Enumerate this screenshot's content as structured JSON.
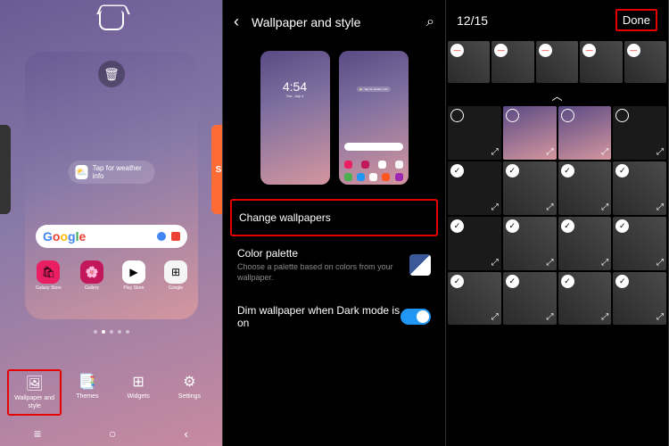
{
  "panel1": {
    "weather_text": "Tap for weather info",
    "apps": [
      {
        "name": "Galaxy Store"
      },
      {
        "name": "Gallery"
      },
      {
        "name": "Play Store"
      },
      {
        "name": "Google"
      }
    ],
    "bottom_items": [
      {
        "icon": "image-icon",
        "label": "Wallpaper and style"
      },
      {
        "icon": "themes-icon",
        "label": "Themes"
      },
      {
        "icon": "widgets-icon",
        "label": "Widgets"
      },
      {
        "icon": "settings-icon",
        "label": "Settings"
      }
    ],
    "peek_right": "Sh"
  },
  "panel2": {
    "title": "Wallpaper and style",
    "preview_time": "4:54",
    "preview_date": "Tue, July 4",
    "settings": [
      {
        "title": "Change wallpapers"
      },
      {
        "title": "Color palette",
        "sub": "Choose a palette based on colors from your wallpaper."
      },
      {
        "title": "Dim wallpaper when Dark mode is on"
      }
    ]
  },
  "panel3": {
    "counter": "12/15",
    "done": "Done"
  }
}
